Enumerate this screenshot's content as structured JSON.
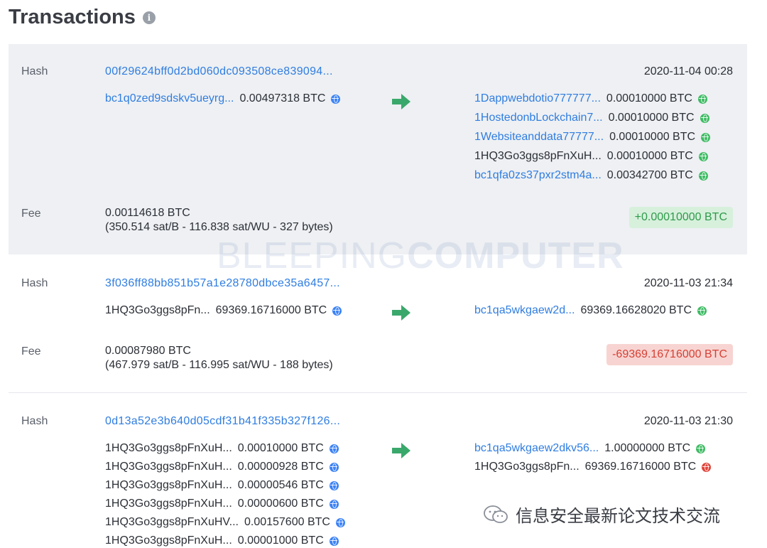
{
  "page": {
    "title": "Transactions"
  },
  "watermark": {
    "light": "BLEEPING",
    "bold": "COMPUTER"
  },
  "footer": {
    "label": "信息安全最新论文技术交流"
  },
  "colors": {
    "link": "#2f7de1",
    "positive": "#2e9a4b",
    "negative": "#d64035",
    "arrow": "#3aa86b"
  },
  "transactions": [
    {
      "hash_label": "Hash",
      "hash": "00f29624bff0d2bd060dc093508ce839094...",
      "date": "2020-11-04 00:28",
      "inputs": [
        {
          "address": "bc1q0zed9sdskv5ueyrg...",
          "amount": "0.00497318 BTC",
          "icon": "globe-blue"
        }
      ],
      "outputs": [
        {
          "address": "1Dappwebdotio777777...",
          "amount": "0.00010000 BTC",
          "icon": "globe-green"
        },
        {
          "address": "1HostedonbLockchain7...",
          "amount": "0.00010000 BTC",
          "icon": "globe-green"
        },
        {
          "address": "1Websiteanddata77777...",
          "amount": "0.00010000 BTC",
          "icon": "globe-green"
        },
        {
          "address": "1HQ3Go3ggs8pFnXuH...",
          "amount": "0.00010000 BTC",
          "icon": "globe-green"
        },
        {
          "address": "bc1qfa0zs37pxr2stm4a...",
          "amount": "0.00342700 BTC",
          "icon": "globe-green"
        }
      ],
      "fee_label": "Fee",
      "fee": "0.00114618 BTC",
      "fee_detail": "(350.514 sat/B - 116.838 sat/WU - 327 bytes)",
      "net": "+0.00010000 BTC"
    },
    {
      "hash_label": "Hash",
      "hash": "3f036ff88bb851b57a1e28780dbce35a6457...",
      "date": "2020-11-03 21:34",
      "inputs": [
        {
          "address": "1HQ3Go3ggs8pFn...",
          "amount": "69369.16716000 BTC",
          "icon": "globe-blue"
        }
      ],
      "outputs": [
        {
          "address": "bc1qa5wkgaew2d...",
          "amount": "69369.16628020 BTC",
          "icon": "globe-green"
        }
      ],
      "fee_label": "Fee",
      "fee": "0.00087980 BTC",
      "fee_detail": "(467.979 sat/B - 116.995 sat/WU - 188 bytes)",
      "net": "-69369.16716000 BTC"
    },
    {
      "hash_label": "Hash",
      "hash": "0d13a52e3b640d05cdf31b41f335b327f126...",
      "date": "2020-11-03 21:30",
      "inputs": [
        {
          "address": "1HQ3Go3ggs8pFnXuH...",
          "amount": "0.00010000 BTC",
          "icon": "globe-blue"
        },
        {
          "address": "1HQ3Go3ggs8pFnXuH...",
          "amount": "0.00000928 BTC",
          "icon": "globe-blue"
        },
        {
          "address": "1HQ3Go3ggs8pFnXuH...",
          "amount": "0.00000546 BTC",
          "icon": "globe-blue"
        },
        {
          "address": "1HQ3Go3ggs8pFnXuH...",
          "amount": "0.00000600 BTC",
          "icon": "globe-blue"
        },
        {
          "address": "1HQ3Go3ggs8pFnXuHV...",
          "amount": "0.00157600 BTC",
          "icon": "globe-blue"
        },
        {
          "address": "1HQ3Go3ggs8pFnXuH...",
          "amount": "0.00001000 BTC",
          "icon": "globe-blue"
        }
      ],
      "outputs": [
        {
          "address": "bc1qa5wkgaew2dkv56...",
          "amount": "1.00000000 BTC",
          "icon": "globe-green"
        },
        {
          "address": "1HQ3Go3ggs8pFn...",
          "amount": "69369.16716000 BTC",
          "icon": "globe-red"
        }
      ]
    }
  ]
}
